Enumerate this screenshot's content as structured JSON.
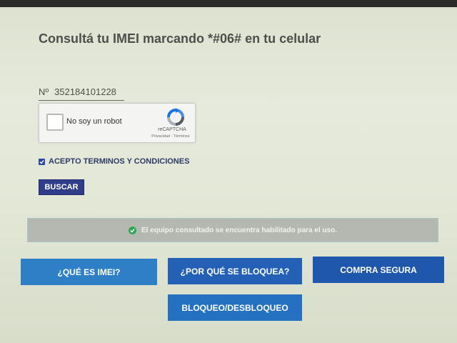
{
  "page": {
    "title": "Consultá tu IMEI marcando *#06# en tu celular"
  },
  "imei": {
    "prefix": "Nº",
    "value": "352184101228"
  },
  "captcha": {
    "label": "No soy un robot",
    "brand": "reCAPTCHA",
    "links": "Privacidad - Términos"
  },
  "terms": {
    "checked": true,
    "label": "ACEPTO TERMINOS Y CONDICIONES"
  },
  "search": {
    "label": "BUSCAR"
  },
  "result": {
    "status": "success",
    "message": "El equipo consultado se encuentra habilitado para el uso."
  },
  "nav": {
    "what_is_imei": "¿QUÉ ES IMEI?",
    "why_blocked": "¿POR QUÉ SE BLOQUEA?",
    "safe_purchase": "COMPRA SEGURA",
    "block_unblock": "BLOQUEO/DESBLOQUEO"
  },
  "colors": {
    "primary_dark": "#2f3d8a",
    "button_blue": "#2460b5",
    "success_green": "#2fa75a"
  }
}
